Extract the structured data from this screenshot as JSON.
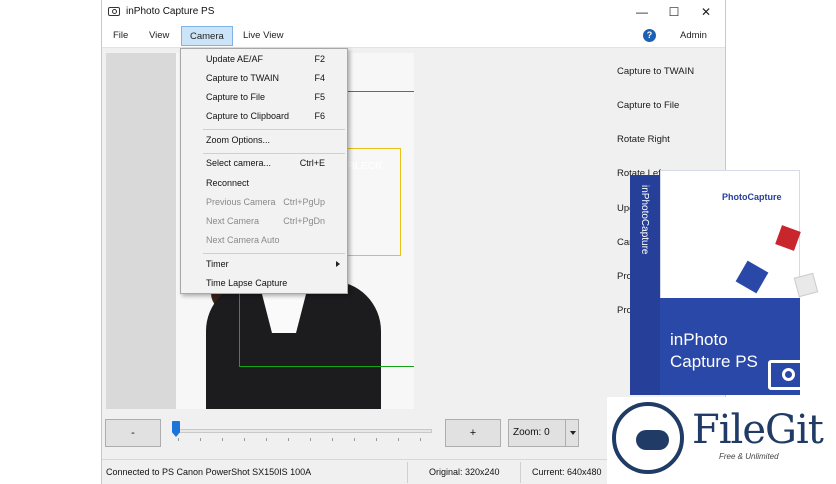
{
  "window": {
    "title": "inPhoto Capture PS",
    "controls": [
      "—",
      "☐",
      "✕"
    ]
  },
  "menubar": {
    "items": [
      "File",
      "View",
      "Camera",
      "Live View"
    ],
    "active": "Camera",
    "help_glyph": "?",
    "user": "Admin"
  },
  "camera_menu": {
    "items": [
      {
        "label": "Update AE/AF",
        "shortcut": "F2",
        "enabled": true
      },
      {
        "label": "Capture to TWAIN",
        "shortcut": "F4",
        "enabled": true
      },
      {
        "label": "Capture to File",
        "shortcut": "F5",
        "enabled": true
      },
      {
        "label": "Capture to Clipboard",
        "shortcut": "F6",
        "enabled": true
      },
      {
        "label": "Zoom Options...",
        "shortcut": "",
        "enabled": true
      },
      {
        "label": "Select camera...",
        "shortcut": "Ctrl+E",
        "enabled": true
      },
      {
        "label": "Reconnect",
        "shortcut": "",
        "enabled": true
      },
      {
        "label": "Previous Camera",
        "shortcut": "Ctrl+PgUp",
        "enabled": false
      },
      {
        "label": "Next Camera",
        "shortcut": "Ctrl+PgDn",
        "enabled": false
      },
      {
        "label": "Next Camera Auto",
        "shortcut": "",
        "enabled": false
      },
      {
        "label": "Timer",
        "shortcut": "",
        "enabled": true,
        "submenu": true
      },
      {
        "label": "Time Lapse Capture",
        "shortcut": "",
        "enabled": true
      }
    ]
  },
  "preview": {
    "watermark": "FILECR"
  },
  "side_buttons": [
    "Capture to TWAIN",
    "Capture to File",
    "Rotate Right",
    "Rotate Lef",
    "Upc",
    "Can",
    "Pro",
    "Pro"
  ],
  "zoom_controls": {
    "minus": "-",
    "plus": "+",
    "zoom_value": "Zoom: 0",
    "slider_level": 0
  },
  "status": {
    "connection": "Connected to PS Canon PowerShot SX150IS 100A",
    "original": "Original: 320x240",
    "current": "Current: 640x480"
  },
  "product_box": {
    "side_text": "inPhotoCapture",
    "logo": "PhotoCapture",
    "name_line1": "inPhoto",
    "name_line2": "Capture PS",
    "accent": "#2a48a8"
  },
  "badge": {
    "name": "FileGit",
    "tagline": "Free & Unlimited",
    "color": "#1f3b66"
  }
}
